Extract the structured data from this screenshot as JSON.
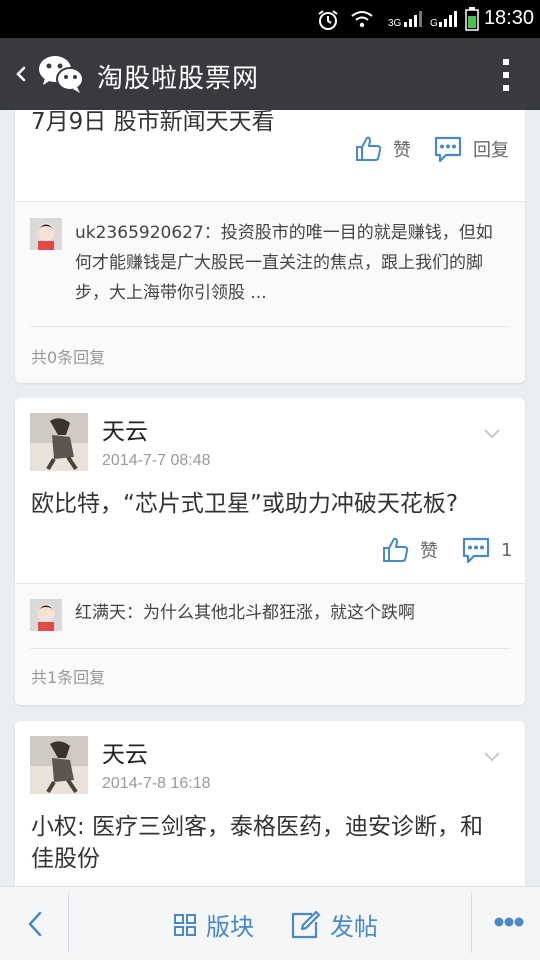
{
  "status_bar": {
    "time": "18:30",
    "icons": [
      "alarm-icon",
      "wifi-icon",
      "signal-3g-icon",
      "signal-g-icon",
      "battery-icon"
    ]
  },
  "header": {
    "title": "淘股啦股票网",
    "back_icon": "chevron-left-icon",
    "logo_icon": "wechat-icon",
    "menu_icon": "more-vertical-icon"
  },
  "posts": [
    {
      "text": "7月9日 股市新闻天天看",
      "like_label": "赞",
      "reply_label": "回复",
      "comments": [
        {
          "name": "uk2365920627",
          "text": "投资股市的唯一目的就是赚钱，但如何才能赚钱是广大股民一直关注的焦点，跟上我们的脚步，大上海带你引领股 ..."
        }
      ],
      "reply_count": "共0条回复"
    },
    {
      "author": "天云",
      "date": "2014-7-7 08:48",
      "text": "欧比特，“芯片式卫星”或助力冲破天花板?",
      "like_label": "赞",
      "reply_label": "1",
      "comments": [
        {
          "name": "红满天",
          "text": "为什么其他北斗都狂涨，就这个跌啊"
        }
      ],
      "reply_count": "共1条回复"
    },
    {
      "author": "天云",
      "date": "2014-7-8 16:18",
      "text_line1": "小权: 医疗三剑客，泰格医药，迪安诊断，和",
      "text_line2": "佳股份"
    }
  ],
  "bottom_bar": {
    "back_icon": "chevron-left-icon",
    "section_label": "版块",
    "post_label": "发帖",
    "more_icon": "more-horizontal-icon"
  },
  "colors": {
    "title_bar": "#393a3f",
    "accent": "#4a89c8",
    "background": "#eaedf1"
  }
}
